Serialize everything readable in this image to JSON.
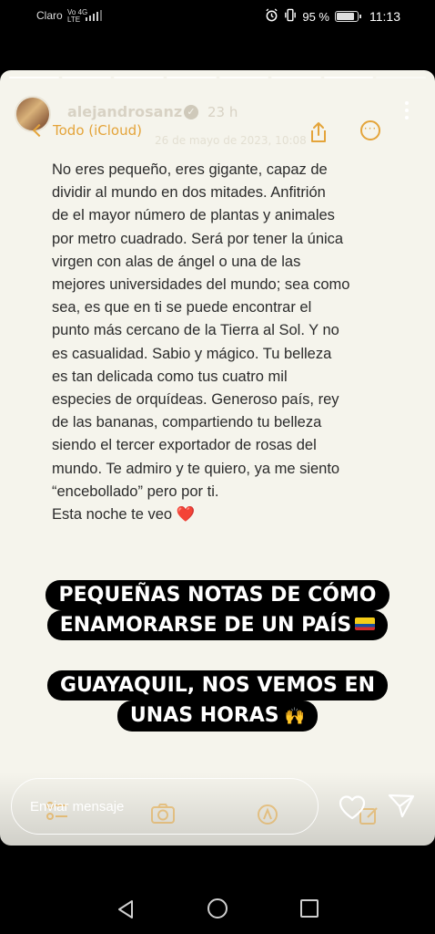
{
  "status_bar": {
    "carrier": "Claro",
    "network_top": "Vo 4G",
    "network_bottom": "LTE",
    "battery_text": "95 %",
    "battery_level": 0.95,
    "time": "11:13"
  },
  "story": {
    "progress_segments": 8,
    "active_segments": 7,
    "username": "alejandrosanz",
    "verified_mark": "✓",
    "posted_ago": "23 h"
  },
  "notes_header": {
    "back_label": "Todo (iCloud)",
    "date_faint": "26 de mayo de 2023, 10:08",
    "more_label": "···"
  },
  "note_lines": [
    "No eres pequeño, eres gigante, capaz de",
    "dividir al mundo en dos mitades. Anfitrión",
    "de el mayor número de plantas y animales",
    "por metro cuadrado. Será por tener la única",
    "virgen con alas de ángel o una de las",
    "mejores universidades del mundo; sea como",
    "sea, es que en ti se puede encontrar el",
    "punto más cercano de la Tierra al Sol. Y no",
    "es casualidad. Sabio y mágico. Tu belleza",
    "es tan delicada como tus cuatro mil",
    "especies de orquídeas. Generoso país, rey",
    "de las bananas, compartiendo tu belleza",
    "siendo el tercer exportador de rosas del",
    "mundo. Te admiro y te quiero, ya me siento",
    "“encebollado” pero por ti.",
    "Esta noche te veo ❤️"
  ],
  "stickers": {
    "first_line1": "PEQUEÑAS NOTAS DE CÓMO",
    "first_line2": "ENAMORARSE DE UN PAÍS",
    "second_line1": "GUAYAQUIL, NOS VEMOS EN",
    "second_line2": "UNAS HORAS",
    "second_emoji": "🙌"
  },
  "reply_bar": {
    "placeholder": "Enviar mensaje"
  },
  "colors": {
    "note_background": "#f5f4ec",
    "accent": "#e4a43a",
    "heart": "#e0242f"
  }
}
